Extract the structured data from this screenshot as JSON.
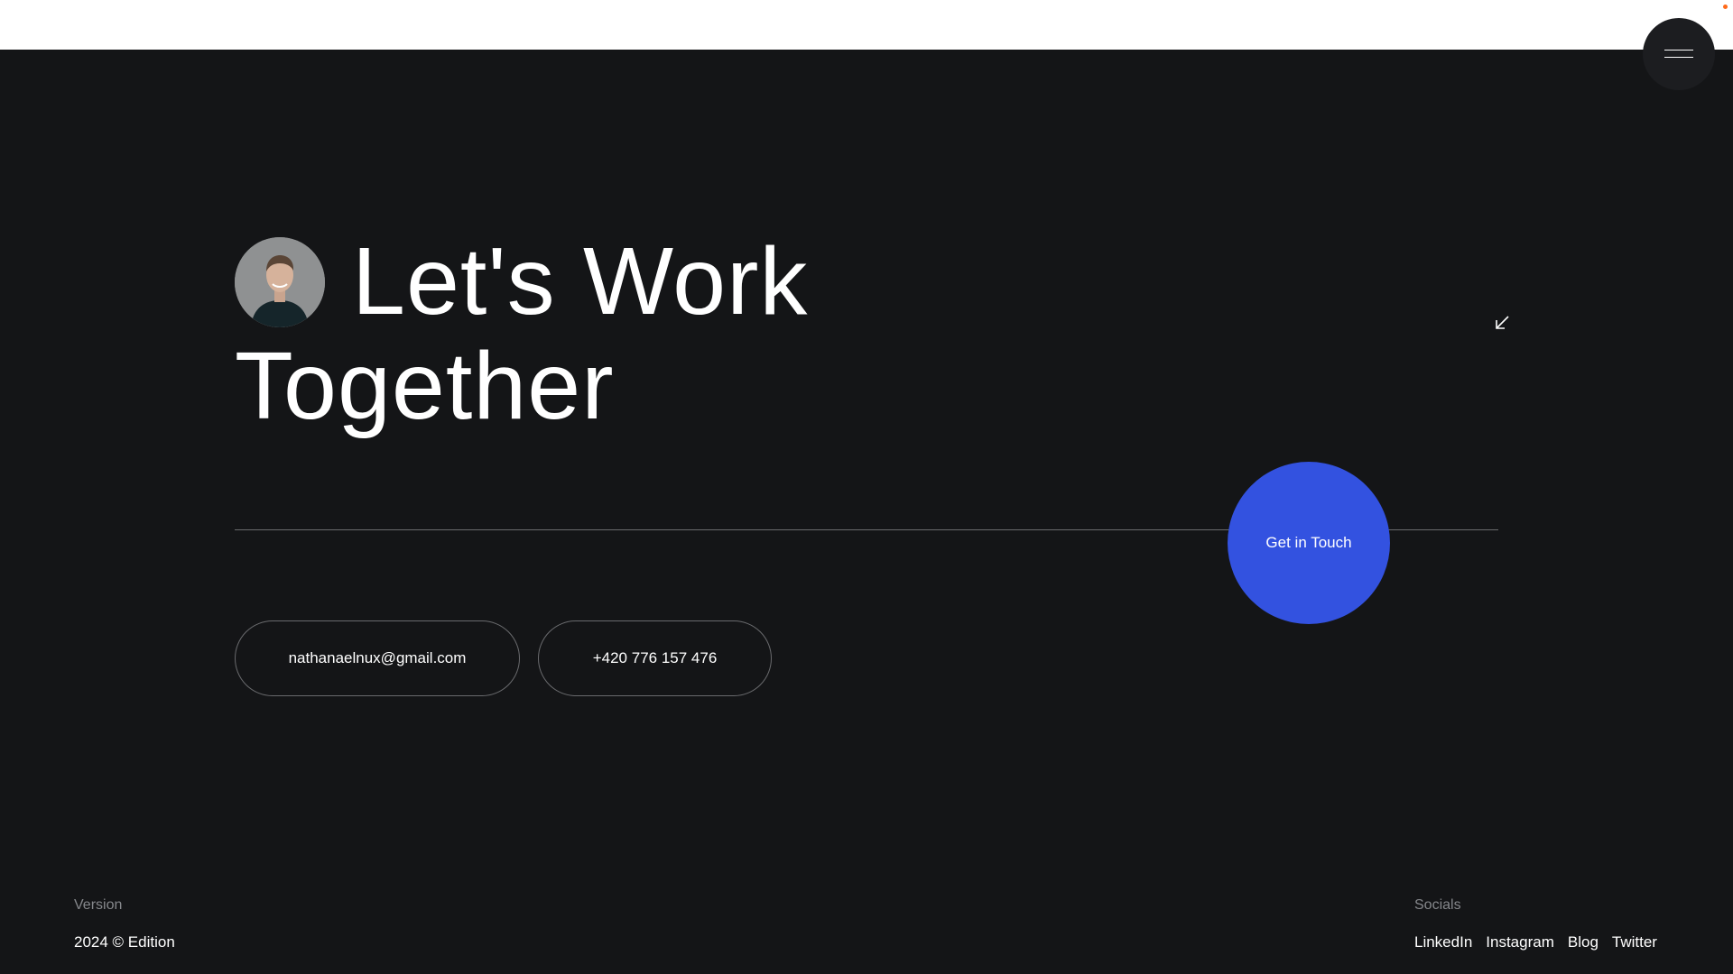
{
  "headline": {
    "line1": "Let's Work",
    "line2": "Together"
  },
  "cta": {
    "label": "Get in Touch",
    "color": "#3352e0"
  },
  "contact": {
    "email": "nathanaelnux@gmail.com",
    "phone": "+420 776 157 476"
  },
  "footer": {
    "version_label": "Version",
    "version_value": "2024 © Edition",
    "socials_label": "Socials",
    "socials": [
      "LinkedIn",
      "Instagram",
      "Blog",
      "Twitter"
    ]
  },
  "icons": {
    "menu": "hamburger-menu-icon",
    "arrow": "arrow-down-left-icon",
    "avatar": "profile-photo"
  },
  "colors": {
    "background": "#141517",
    "top_strip": "#ffffff",
    "text": "#ffffff",
    "muted_text": "#85878b",
    "accent": "#3352e0"
  }
}
